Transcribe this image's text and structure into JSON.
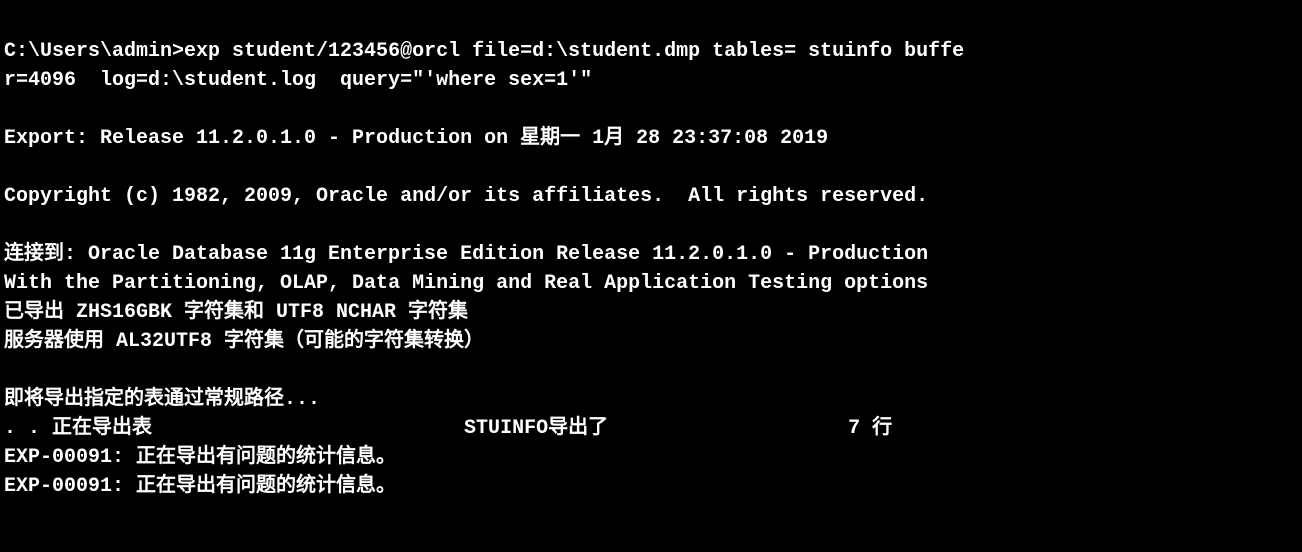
{
  "terminal": {
    "lines": [
      {
        "id": "line1",
        "text": "C:\\Users\\admin>exp student/123456@orcl file=d:\\student.dmp tables= stuinfo buffe",
        "bold": true
      },
      {
        "id": "line2",
        "text": "r=4096  log=d:\\student.log  query=\"'where sex=1'\"",
        "bold": true
      },
      {
        "id": "line3",
        "text": "",
        "bold": false
      },
      {
        "id": "line4",
        "text": "Export: Release 11.2.0.1.0 - Production on 星期一 1月 28 23:37:08 2019",
        "bold": true
      },
      {
        "id": "line5",
        "text": "",
        "bold": false
      },
      {
        "id": "line6",
        "text": "Copyright (c) 1982, 2009, Oracle and/or its affiliates.  All rights reserved.",
        "bold": true
      },
      {
        "id": "line7",
        "text": "",
        "bold": false
      },
      {
        "id": "line8",
        "text": "连接到: Oracle Database 11g Enterprise Edition Release 11.2.0.1.0 - Production",
        "bold": true
      },
      {
        "id": "line9",
        "text": "With the Partitioning, OLAP, Data Mining and Real Application Testing options",
        "bold": true
      },
      {
        "id": "line10",
        "text": "已导出 ZHS16GBK 字符集和 UTF8 NCHAR 字符集",
        "bold": true
      },
      {
        "id": "line11",
        "text": "服务器使用 AL32UTF8 字符集（可能的字符集转换）",
        "bold": true
      },
      {
        "id": "line12",
        "text": "",
        "bold": false
      },
      {
        "id": "line13",
        "text": "即将导出指定的表通过常规路径...",
        "bold": true
      },
      {
        "id": "line14",
        "text": ". . 正在导出表                          STUINFO导出了                    7 行",
        "bold": true
      },
      {
        "id": "line15",
        "text": "EXP-00091: 正在导出有问题的统计信息。",
        "bold": true
      },
      {
        "id": "line16",
        "text": "EXP-00091: 正在导出有问题的统计信息。",
        "bold": true
      }
    ]
  }
}
